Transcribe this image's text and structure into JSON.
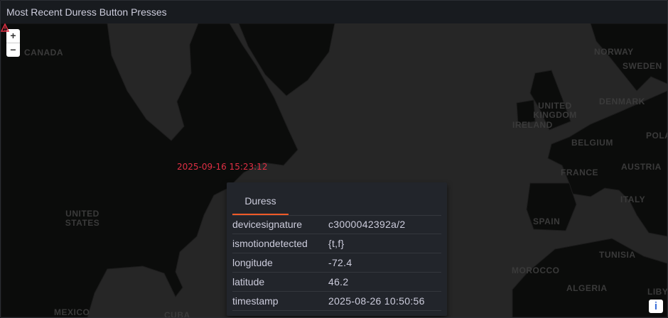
{
  "panel": {
    "title": "Most Recent Duress Button Presses"
  },
  "map": {
    "zoom_in_label": "+",
    "zoom_out_label": "−",
    "info_label": "i",
    "land_color": "#0b0c0b",
    "ocean_color": "#262626",
    "country_labels": [
      "CANADA",
      "UNITED STATES",
      "MEXICO",
      "CUBA",
      "NORWAY",
      "SWEDEN",
      "DENMARK",
      "UNITED KINGDOM",
      "IRELAND",
      "BELGIUM",
      "FRANCE",
      "AUSTRIA",
      "POLA",
      "SPAIN",
      "ITALY",
      "TUNISIA",
      "MOROCCO",
      "ALGERIA",
      "LIBY"
    ],
    "marker": {
      "label": "2025-09-16 15:23:12",
      "icon": "warning-triangle-icon",
      "color": "#e02f44"
    }
  },
  "tooltip": {
    "tab": "Duress",
    "accent": "#f05a28",
    "rows": [
      {
        "key": "devicesignature",
        "value": "c3000042392a/2"
      },
      {
        "key": "ismotiondetected",
        "value": "{t,f}"
      },
      {
        "key": "longitude",
        "value": "-72.4"
      },
      {
        "key": "latitude",
        "value": "46.2"
      },
      {
        "key": "timestamp",
        "value": "2025-08-26 10:50:56"
      }
    ]
  }
}
